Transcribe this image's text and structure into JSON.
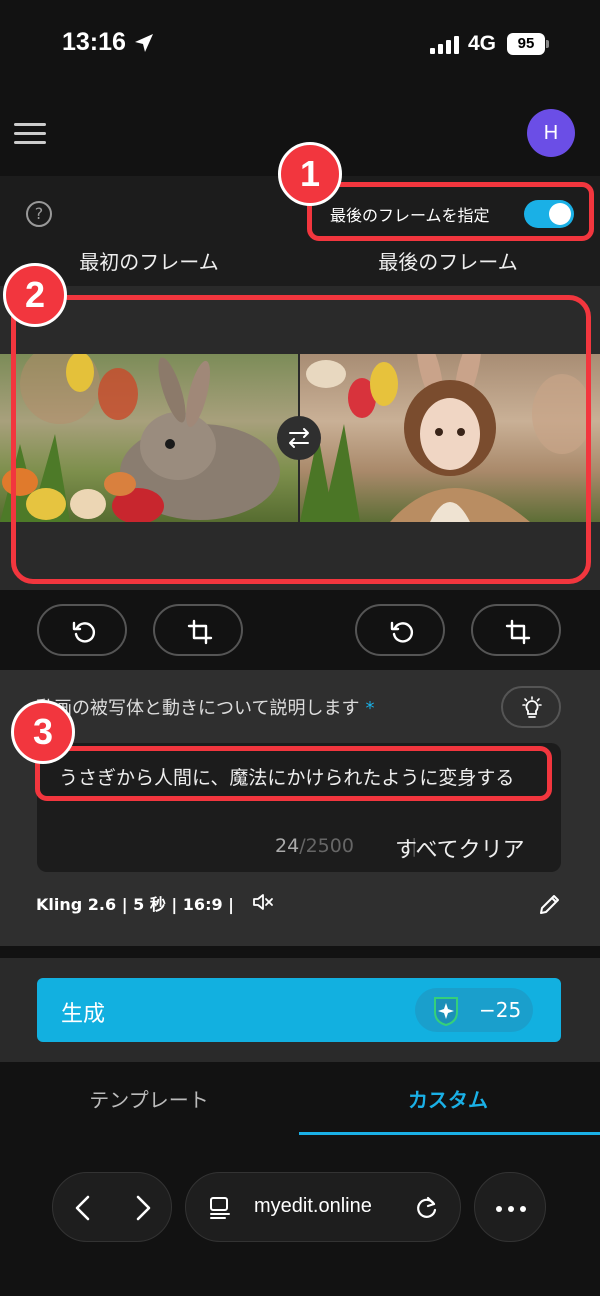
{
  "status_bar": {
    "time": "13:16",
    "network": "4G",
    "battery": "95"
  },
  "header": {
    "avatar_initial": "H"
  },
  "frame_panel": {
    "help": "?",
    "toggle_label": "最後のフレームを指定",
    "toggle_on": true,
    "first_frame_title": "最初のフレーム",
    "last_frame_title": "最後のフレーム"
  },
  "prompt": {
    "label": "動画の被写体と動きについて説明します",
    "required_mark": "*",
    "text": "うさぎから人間に、魔法にかけられたように変身する",
    "count": "24",
    "max": "/2500",
    "separator": "|",
    "clear_label": "すべてクリア",
    "model_info": "Kling 2.6 | 5 秒 | 16:9 |"
  },
  "generate": {
    "label": "生成",
    "cost": "−25"
  },
  "tabs": {
    "template": "テンプレート",
    "custom": "カスタム"
  },
  "browser": {
    "url": "myedit.online"
  },
  "annotations": {
    "one": "1",
    "two": "2",
    "three": "3"
  },
  "colors": {
    "accent": "#1ab0e6",
    "annotation": "#f2363e",
    "avatar": "#6b4ee6"
  }
}
